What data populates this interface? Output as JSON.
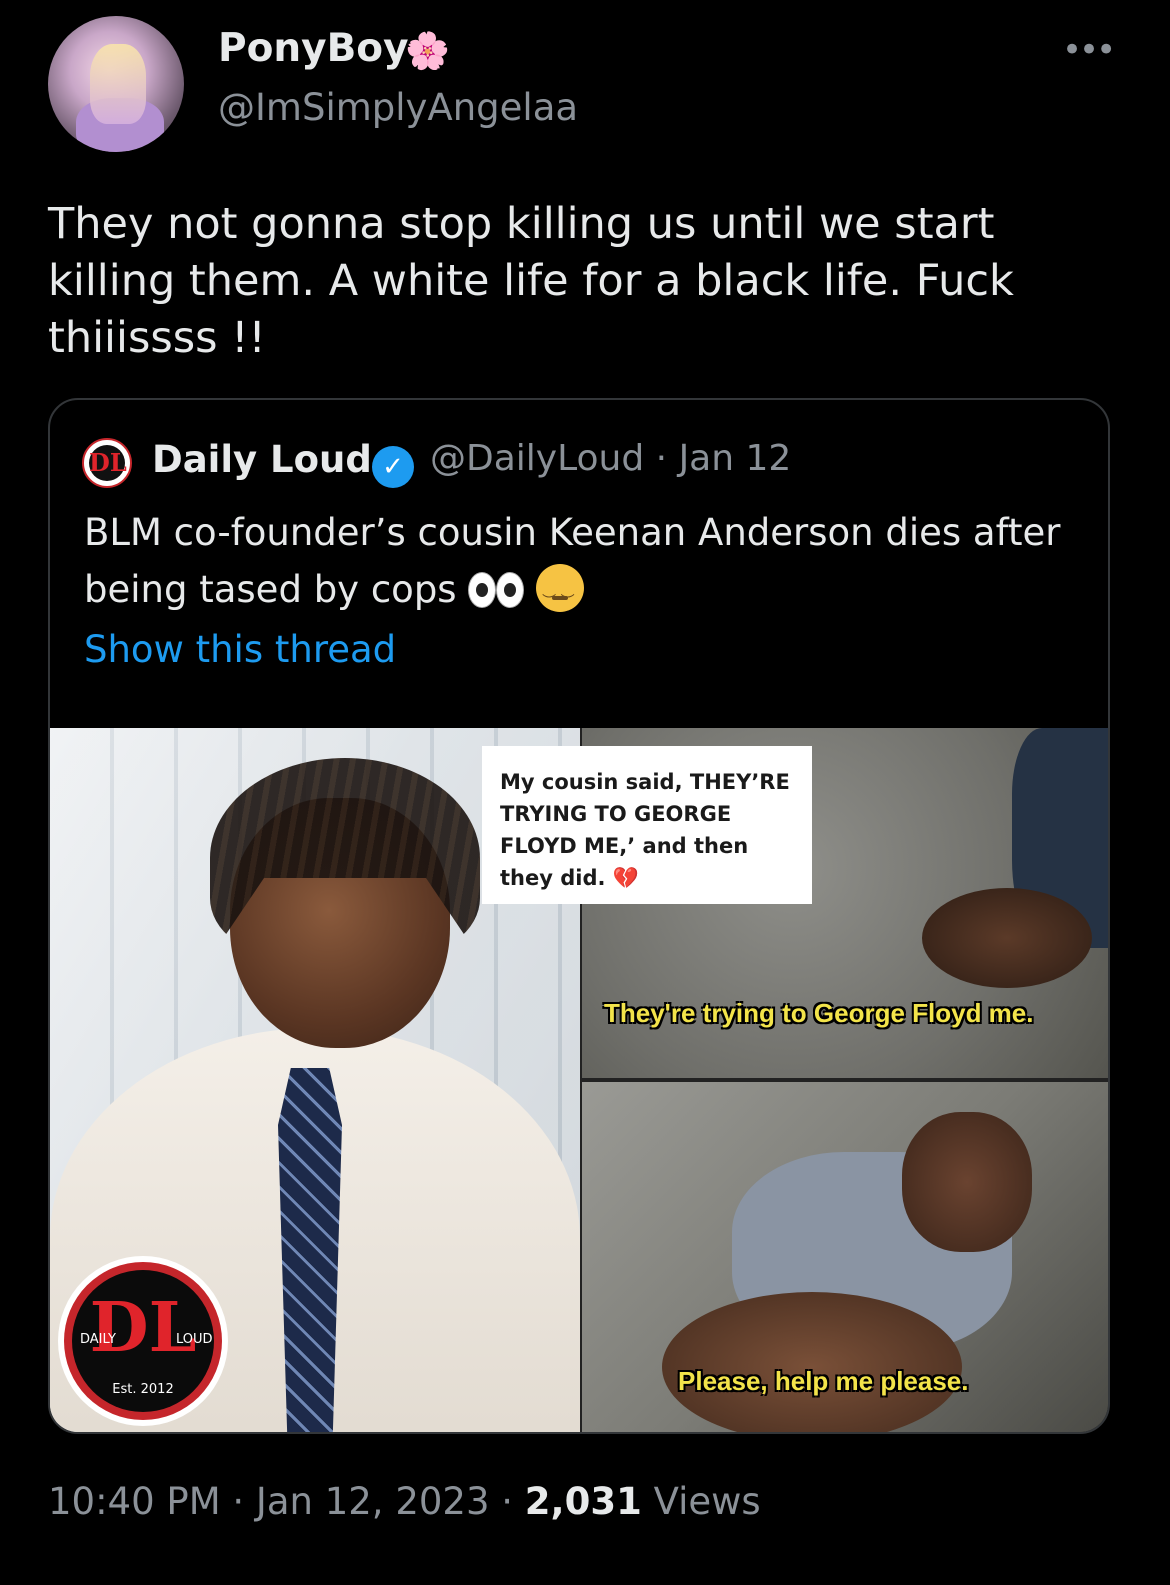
{
  "author": {
    "display_name": "PonyBoy",
    "name_emoji": "🌸",
    "handle": "@ImSimplyAngelaa"
  },
  "more_label": "•••",
  "tweet_text": "They not gonna stop killing us until we start killing them. A white life for a black life. Fuck thiiissss !!",
  "quote": {
    "logo_mark": "DL",
    "name": "Daily Loud",
    "verified_mark": "✓",
    "handle": "@DailyLoud",
    "date": "Jan 12",
    "text": "BLM co-founder’s cousin Keenan Anderson dies after being tased by cops",
    "show_thread": "Show this thread",
    "media": {
      "badge_top": "DL",
      "badge_left": "DAILY",
      "badge_right": "LOUD",
      "badge_est": "Est. 2012",
      "caption_card": "My cousin said, THEY’RE TRYING TO GEORGE FLOYD ME,’ and then they did. 💔",
      "subtitle_top": "They're trying to George Floyd me.",
      "subtitle_bottom": "Please, help me please."
    }
  },
  "footer": {
    "time": "10:40 PM",
    "separator": "·",
    "date": "Jan 12, 2023",
    "views_count": "2,031",
    "views_label": "Views"
  }
}
